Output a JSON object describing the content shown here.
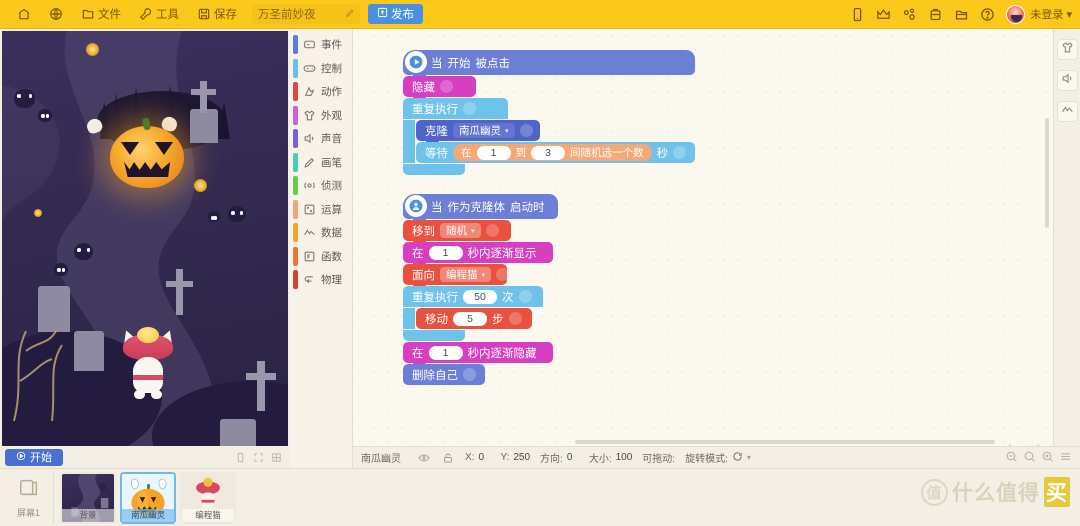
{
  "topbar": {
    "home_label": "home-icon",
    "globe_label": "globe-icon",
    "file_label": "文件",
    "tools_label": "工具",
    "save_label": "保存",
    "project_name": "万圣前妙夜",
    "publish_label": "发布",
    "login_label": "未登录",
    "bg_color": "#fbc91b",
    "publish_color": "#4a90e2",
    "right_icons": [
      "mobile-icon",
      "crown-icon",
      "share-icon",
      "backpack-icon",
      "folder-icon",
      "help-icon"
    ]
  },
  "stage": {
    "start_label": "开始",
    "start_color": "#4a6fd4",
    "bottom_icons": [
      "device-icon",
      "fullscreen-icon",
      "grid-icon"
    ]
  },
  "categories": [
    {
      "label": "事件",
      "color": "#5b7ce0",
      "icon": "event-icon"
    },
    {
      "label": "控制",
      "color": "#65c0ea",
      "icon": "control-icon"
    },
    {
      "label": "动作",
      "color": "#e0453f",
      "icon": "motion-icon"
    },
    {
      "label": "外观",
      "color": "#cf5de0",
      "icon": "looks-icon"
    },
    {
      "label": "声音",
      "color": "#7a60e0",
      "icon": "sound-icon"
    },
    {
      "label": "画笔",
      "color": "#45cdb5",
      "icon": "pen-icon"
    },
    {
      "label": "侦测",
      "color": "#68c94a",
      "icon": "sensing-icon"
    },
    {
      "label": "运算",
      "color": "#f0a480",
      "icon": "operator-icon"
    },
    {
      "label": "数据",
      "color": "#f0a630",
      "icon": "data-icon"
    },
    {
      "label": "函数",
      "color": "#e8763c",
      "icon": "function-icon"
    },
    {
      "label": "物理",
      "color": "#d7402f",
      "icon": "physics-icon"
    }
  ],
  "scripts": [
    {
      "name": "script-green-flag",
      "hat": {
        "text_a": "当",
        "text_b": "开始",
        "text_c": "被点击",
        "color": "#6b7fd7",
        "icon": "play-icon"
      },
      "blocks": [
        {
          "name": "hide-block",
          "label": "隐藏",
          "color": "#d63fc0"
        }
      ],
      "loop": {
        "label": "重复执行",
        "color": "#6fc3ea",
        "children": [
          {
            "name": "clone-block",
            "label": "克隆",
            "color": "#4f63c8",
            "dropdown": "南瓜幽灵",
            "dropdown_color": "#6275d4"
          },
          {
            "name": "wait-block",
            "label": "等待",
            "color": "#6fc3ea",
            "unit": "秒",
            "reporter": {
              "label_a": "在",
              "val_a": "1",
              "label_b": "到",
              "val_b": "3",
              "label_c": "间随机选一个数",
              "color": "#f5a878"
            }
          }
        ]
      }
    },
    {
      "name": "script-clone-start",
      "hat": {
        "text_a": "当",
        "text_b": "作为克隆体",
        "text_c": "启动时",
        "color": "#6b7fd7",
        "icon": "person-icon"
      },
      "blocks": [
        {
          "name": "goto-block",
          "label": "移到",
          "color": "#e8503f",
          "dropdown": "随机",
          "dropdown_color": "#f08878"
        },
        {
          "name": "glide-show-block",
          "label_a": "在",
          "val": "1",
          "label_b": "秒内逐渐显示",
          "color": "#d63fc0"
        },
        {
          "name": "point-toward-block",
          "label": "面向",
          "color": "#e8503f",
          "dropdown": "编程猫",
          "dropdown_color": "#f08878"
        }
      ],
      "loop": {
        "label": "重复执行",
        "count": "50",
        "unit": "次",
        "color": "#6fc3ea",
        "children": [
          {
            "name": "move-steps-block",
            "label": "移动",
            "val": "5",
            "unit": "步",
            "color": "#e8503f"
          }
        ]
      },
      "after": [
        {
          "name": "glide-hide-block",
          "label_a": "在",
          "val": "1",
          "label_b": "秒内逐渐隐藏",
          "color": "#d63fc0"
        },
        {
          "name": "delete-clone-block",
          "label": "删除自己",
          "color": "#6b7fd7"
        }
      ]
    }
  ],
  "statusbar": {
    "sprite_name": "南瓜幽灵",
    "x_label": "X:",
    "x_value": "0",
    "y_label": "Y:",
    "y_value": "250",
    "dir_label": "方向:",
    "dir_value": "0",
    "size_label": "大小:",
    "size_value": "100",
    "drag_label": "可拖动:",
    "rotate_label": "旋转模式:",
    "eye_icon": "eye-icon",
    "lock_icon": "unlock-icon",
    "zoom_icons": [
      "zoom-out-icon",
      "zoom-reset-icon",
      "zoom-in-icon",
      "list-icon"
    ]
  },
  "rail": [
    {
      "name": "costume-tab",
      "icon": "shirt-icon"
    },
    {
      "name": "sound-tab",
      "icon": "speaker-icon"
    },
    {
      "name": "data-tab",
      "icon": "chart-icon"
    }
  ],
  "tray": {
    "stage_label": "屏幕1",
    "sprites": [
      {
        "name": "背景",
        "selected": false,
        "kind": "background"
      },
      {
        "name": "南瓜幽灵",
        "selected": true,
        "kind": "pumpkin"
      },
      {
        "name": "编程猫",
        "selected": false,
        "kind": "cat"
      }
    ]
  },
  "watermark": {
    "mark": "值",
    "text": "什么值得",
    "tail": "买"
  }
}
